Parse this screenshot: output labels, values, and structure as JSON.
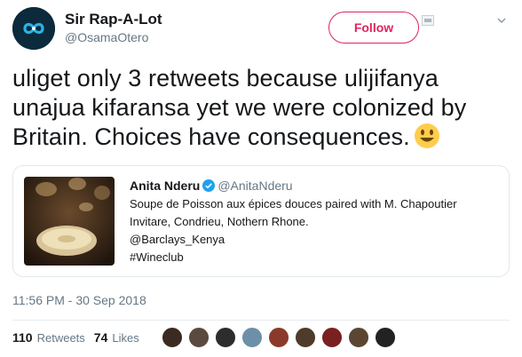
{
  "author": {
    "display_name": "Sir Rap-A-Lot",
    "handle": "@OsamaOtero",
    "avatar_icon": "infinity-logo-avatar"
  },
  "follow_label": "Follow",
  "tweet": {
    "text_lines": [
      "uliget only 3 retweets because ulijifanya",
      "unajua kifaransa yet we were colonized by",
      "Britain. Choices have consequences."
    ],
    "emoji": "smiley-face-icon"
  },
  "quoted": {
    "name": "Anita Nderu",
    "handle": "@AnitaNderu",
    "lines": [
      "Soupe de Poisson aux épices douces paired with M. Chapoutier",
      "Invitare, Condrieu, Nothern Rhone.",
      "@Barclays_Kenya",
      "#Wineclub"
    ]
  },
  "timestamp": "11:56 PM - 30 Sep 2018",
  "stats": {
    "retweets_count": "110",
    "retweets_label": "Retweets",
    "likes_count": "74",
    "likes_label": "Likes"
  },
  "colors": {
    "follow": "#e0245e",
    "verified": "#1da1f2",
    "muted": "#657786"
  },
  "liker_colors": [
    "#3b2a22",
    "#5a4a3f",
    "#2d2d2d",
    "#6d8fa8",
    "#8a3a2a",
    "#4e3b2a",
    "#7a2020",
    "#5b4634",
    "#222222"
  ]
}
